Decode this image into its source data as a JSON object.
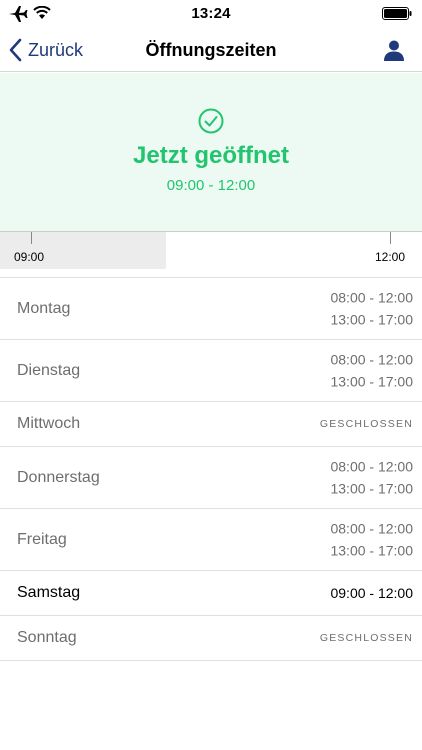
{
  "status_bar": {
    "time": "13:24",
    "icons": [
      "airplane-icon",
      "wifi-icon",
      "battery-icon"
    ]
  },
  "nav": {
    "back_label": "Zurück",
    "title": "Öffnungszeiten",
    "right_icon": "user-icon",
    "accent_color": "#1f3a7a"
  },
  "status": {
    "icon": "check-circle-icon",
    "title": "Jetzt geöffnet",
    "hours": "09:00 - 12:00",
    "color": "#22c46e",
    "background": "#ecfaf3"
  },
  "timeline": {
    "start_label": "09:00",
    "end_label": "12:00",
    "progress": 0.37
  },
  "days": [
    {
      "name": "Montag",
      "hours": [
        "08:00 - 12:00",
        "13:00 - 17:00"
      ],
      "today": false
    },
    {
      "name": "Dienstag",
      "hours": [
        "08:00 - 12:00",
        "13:00 - 17:00"
      ],
      "today": false
    },
    {
      "name": "Mittwoch",
      "closed_label": "GESCHLOSSEN",
      "today": false
    },
    {
      "name": "Donnerstag",
      "hours": [
        "08:00 - 12:00",
        "13:00 - 17:00"
      ],
      "today": false
    },
    {
      "name": "Freitag",
      "hours": [
        "08:00 - 12:00",
        "13:00 - 17:00"
      ],
      "today": false
    },
    {
      "name": "Samstag",
      "hours": [
        "09:00 - 12:00"
      ],
      "today": true
    },
    {
      "name": "Sonntag",
      "closed_label": "GESCHLOSSEN",
      "today": false
    }
  ]
}
